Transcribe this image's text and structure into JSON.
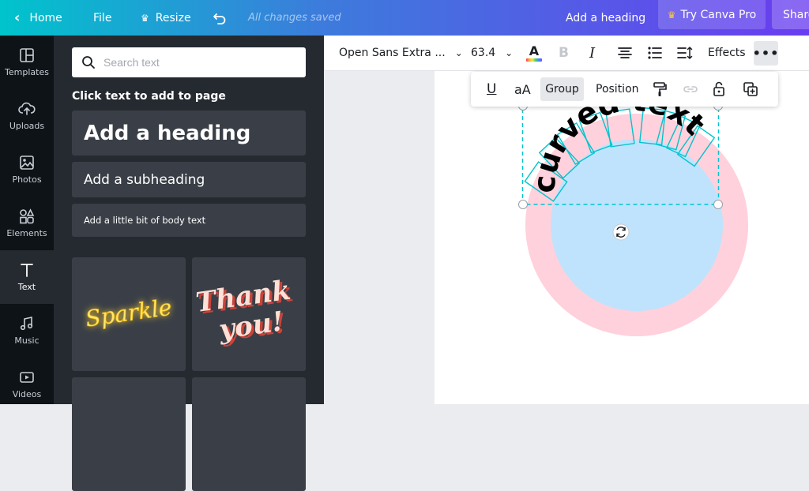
{
  "topbar": {
    "home_label": "Home",
    "file_label": "File",
    "resize_label": "Resize",
    "save_status": "All changes saved",
    "add_heading_label": "Add a heading",
    "try_pro_label": "Try Canva Pro",
    "share_label": "Share"
  },
  "rail": {
    "items": [
      {
        "label": "Templates",
        "icon": "templates-icon"
      },
      {
        "label": "Uploads",
        "icon": "upload-icon"
      },
      {
        "label": "Photos",
        "icon": "photo-icon"
      },
      {
        "label": "Elements",
        "icon": "shapes-icon"
      },
      {
        "label": "Text",
        "icon": "text-icon"
      },
      {
        "label": "Music",
        "icon": "music-note-icon"
      },
      {
        "label": "Videos",
        "icon": "video-icon"
      }
    ],
    "active": "Text"
  },
  "panel": {
    "search_placeholder": "Search text",
    "section_title": "Click text to add to page",
    "heading_label": "Add a heading",
    "subheading_label": "Add a subheading",
    "body_label": "Add a little bit of body text",
    "templates": [
      {
        "text": "Sparkle",
        "color": "#ffe873"
      },
      {
        "text": "Thank",
        "text2": "you!",
        "color": "#fde0d6"
      }
    ]
  },
  "toolbar": {
    "font_name": "Open Sans Extra ...",
    "font_size": "63.4",
    "bold_label": "B",
    "italic_label": "I",
    "effects_label": "Effects",
    "more_label": "•••"
  },
  "subbar": {
    "underline_label": "U",
    "case_label": "aA",
    "group_label": "Group",
    "position_label": "Position"
  },
  "canvas": {
    "curved_text": "curved text",
    "outer_circle_color": "#ffd1dc",
    "inner_circle_color": "#bfe3fc",
    "selection_color": "#00c4cc"
  }
}
